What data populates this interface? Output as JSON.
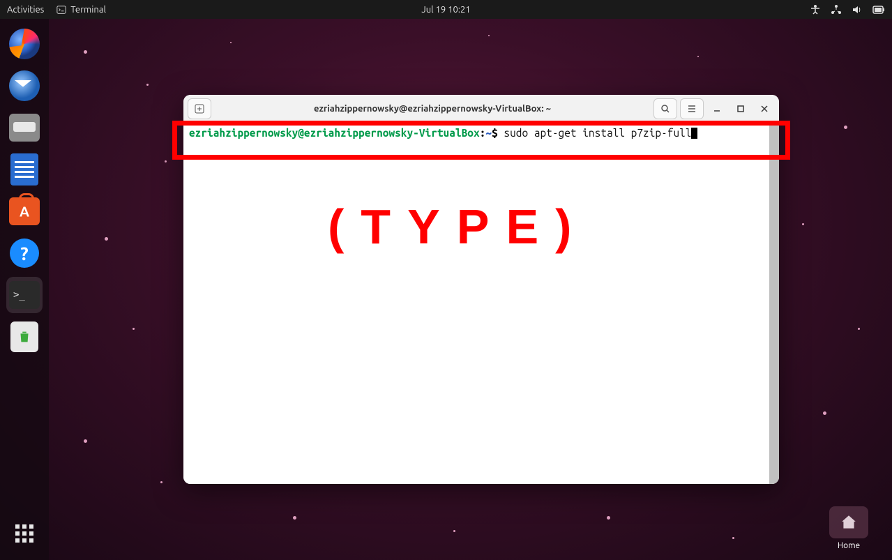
{
  "topbar": {
    "activities_label": "Activities",
    "app_label": "Terminal",
    "datetime": "Jul 19  10:21"
  },
  "dock": {
    "items": [
      {
        "name": "firefox"
      },
      {
        "name": "thunderbird"
      },
      {
        "name": "files"
      },
      {
        "name": "libreoffice-writer"
      },
      {
        "name": "ubuntu-software"
      },
      {
        "name": "help"
      },
      {
        "name": "terminal"
      },
      {
        "name": "trash"
      }
    ]
  },
  "desktop": {
    "home_label": "Home"
  },
  "terminal": {
    "title": "ezriahzippernowsky@ezriahzippernowsky-VirtualBox: ~",
    "prompt_user_host": "ezriahzippernowsky@ezriahzippernowsky-VirtualBox",
    "prompt_colon": ":",
    "prompt_path": "~",
    "prompt_dollar": "$",
    "command": " sudo apt-get install p7zip-full"
  },
  "annotation": {
    "type_label": "(TYPE)"
  }
}
